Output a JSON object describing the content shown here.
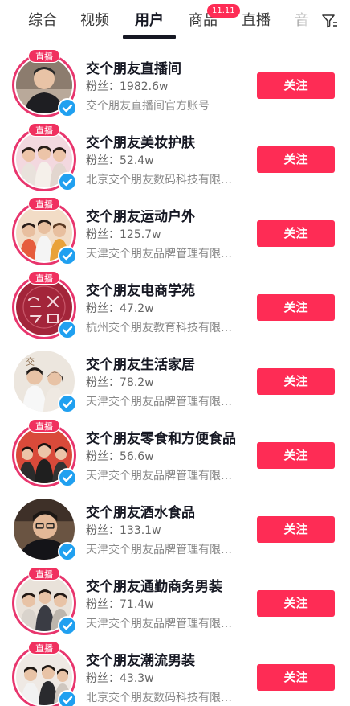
{
  "tabs": [
    {
      "label": "综合"
    },
    {
      "label": "视频"
    },
    {
      "label": "用户"
    },
    {
      "label": "商品"
    },
    {
      "label": "直播"
    },
    {
      "label": "音"
    }
  ],
  "tab_badge": "11.11",
  "active_tab": "用户",
  "icons": {
    "filter": "filter-icon",
    "verified": "verified-check-icon"
  },
  "colors": {
    "accent": "#fe2c55",
    "ring": "#e8356d",
    "verify": "#20a0f0"
  },
  "live_tag": "直播",
  "follow_label": "关注",
  "accounts": [
    {
      "name": "交个朋友直播间",
      "fans": "粉丝：1982.6w",
      "desc": "交个朋友直播间官方账号",
      "live": true
    },
    {
      "name": "交个朋友美妆护肤",
      "fans": "粉丝：52.4w",
      "desc": "北京交个朋友数码科技有限…",
      "live": true
    },
    {
      "name": "交个朋友运动户外",
      "fans": "粉丝：125.7w",
      "desc": "天津交个朋友品牌管理有限…",
      "live": true
    },
    {
      "name": "交个朋友电商学苑",
      "fans": "粉丝：47.2w",
      "desc": "杭州交个朋友教育科技有限…",
      "live": true
    },
    {
      "name": "交个朋友生活家居",
      "fans": "粉丝：78.2w",
      "desc": "天津交个朋友品牌管理有限…",
      "live": false
    },
    {
      "name": "交个朋友零食和方便食品",
      "fans": "粉丝：56.6w",
      "desc": "天津交个朋友品牌管理有限…",
      "live": true
    },
    {
      "name": "交个朋友酒水食品",
      "fans": "粉丝：133.1w",
      "desc": "天津交个朋友品牌管理有限…",
      "live": false
    },
    {
      "name": "交个朋友通勤商务男装",
      "fans": "粉丝：71.4w",
      "desc": "天津交个朋友品牌管理有限…",
      "live": true
    },
    {
      "name": "交个朋友潮流男装",
      "fans": "粉丝：43.3w",
      "desc": "北京交个朋友数码科技有限…",
      "live": true
    }
  ]
}
